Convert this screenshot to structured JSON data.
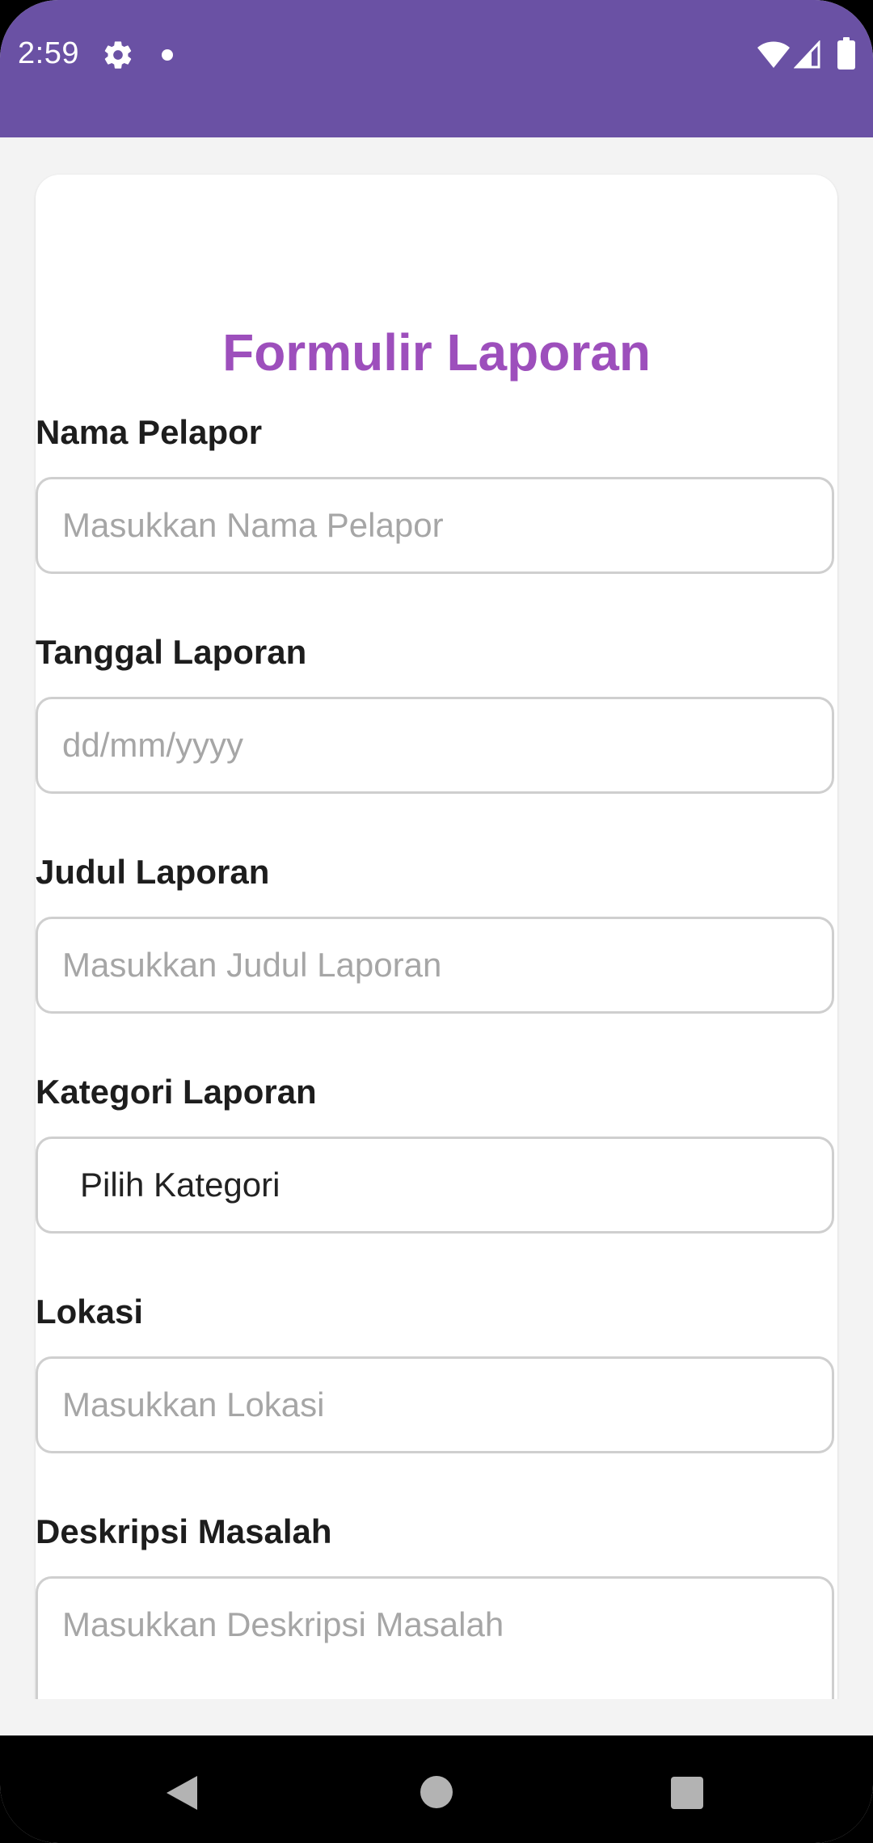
{
  "status_bar": {
    "time": "2:59",
    "icons": [
      "gear-icon",
      "notification-dot-icon",
      "wifi-icon",
      "signal-icon",
      "battery-icon"
    ]
  },
  "form": {
    "title": "Formulir Laporan",
    "fields": [
      {
        "label": "Nama Pelapor",
        "placeholder": "Masukkan Nama Pelapor"
      },
      {
        "label": "Tanggal Laporan",
        "placeholder": "dd/mm/yyyy"
      },
      {
        "label": "Judul Laporan",
        "placeholder": "Masukkan Judul Laporan"
      },
      {
        "label": "Kategori Laporan",
        "value": "Pilih Kategori"
      },
      {
        "label": "Lokasi",
        "placeholder": "Masukkan Lokasi"
      },
      {
        "label": "Deskripsi Masalah",
        "placeholder": "Masukkan Deskripsi Masalah"
      }
    ]
  },
  "nav_bar": {
    "icons": [
      "back-icon",
      "home-icon",
      "recents-icon"
    ]
  },
  "colors": {
    "status_bar": "#6a51a4",
    "title": "#9d4fbc",
    "background": "#f3f3f3",
    "card": "#ffffff",
    "field_border": "#cfcfcf",
    "placeholder": "#a6a6a6"
  }
}
